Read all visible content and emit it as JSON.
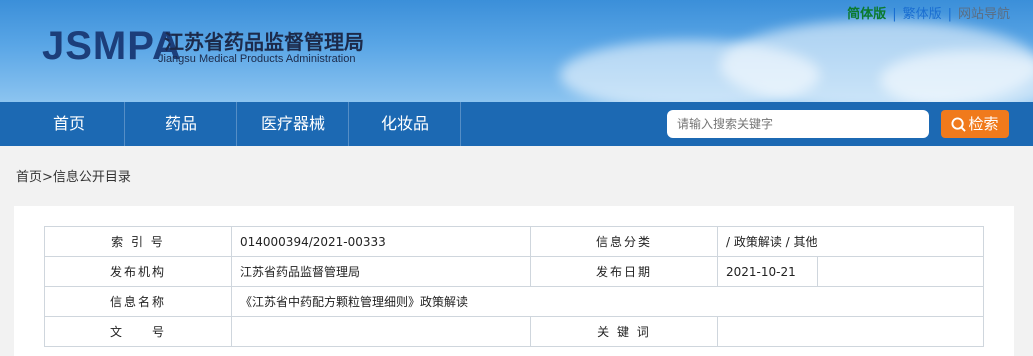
{
  "header": {
    "logo_en": "JSMPA",
    "logo_cn": "江苏省药品监督管理局",
    "logo_sub": "Jiangsu Medical Products Administration",
    "lang_simplified": "简体版",
    "lang_separator": "|",
    "lang_traditional": "繁体版",
    "site_map": "网站导航"
  },
  "nav": {
    "items": [
      {
        "label": "首页"
      },
      {
        "label": "药品"
      },
      {
        "label": "医疗器械"
      },
      {
        "label": "化妆品"
      }
    ],
    "search_placeholder": "请输入搜索关键字",
    "search_button": "检索"
  },
  "breadcrumb": "首页>信息公开目录",
  "info": {
    "index_label": "索 引 号",
    "index_value": "014000394/2021-00333",
    "category_label": "信息分类",
    "category_value": "/  政策解读  /  其他",
    "org_label": "发布机构",
    "org_value": "江苏省药品监督管理局",
    "date_label": "发布日期",
    "date_value": "2021-10-21",
    "name_label": "信息名称",
    "name_value": "《江苏省中药配方颗粒管理细则》政策解读",
    "doc_label": "文　　号",
    "doc_value": "",
    "keyword_label": "关 键 词",
    "keyword_value": ""
  },
  "colors": {
    "nav_bg": "#1c69b3",
    "search_button_bg": "#f07a1c",
    "logo_text": "#1c3e7a"
  }
}
